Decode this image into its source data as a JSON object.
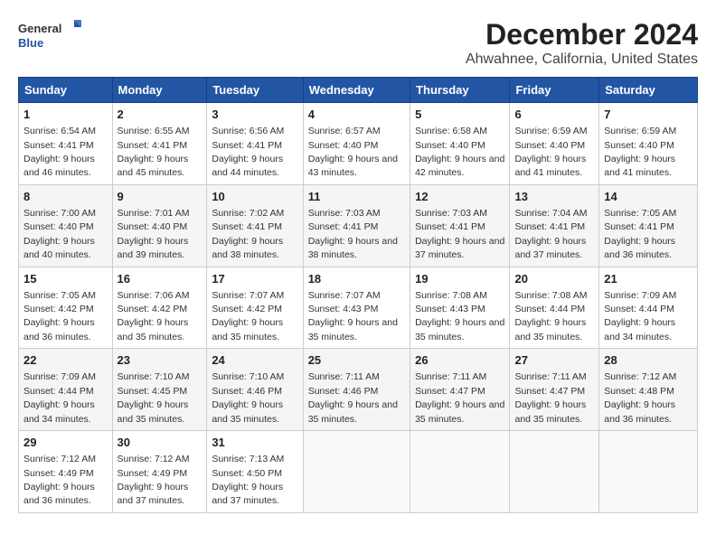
{
  "logo": {
    "general": "General",
    "blue": "Blue"
  },
  "title": "December 2024",
  "subtitle": "Ahwahnee, California, United States",
  "days_of_week": [
    "Sunday",
    "Monday",
    "Tuesday",
    "Wednesday",
    "Thursday",
    "Friday",
    "Saturday"
  ],
  "weeks": [
    [
      {
        "day": "1",
        "sunrise": "6:54 AM",
        "sunset": "4:41 PM",
        "daylight": "9 hours and 46 minutes."
      },
      {
        "day": "2",
        "sunrise": "6:55 AM",
        "sunset": "4:41 PM",
        "daylight": "9 hours and 45 minutes."
      },
      {
        "day": "3",
        "sunrise": "6:56 AM",
        "sunset": "4:41 PM",
        "daylight": "9 hours and 44 minutes."
      },
      {
        "day": "4",
        "sunrise": "6:57 AM",
        "sunset": "4:40 PM",
        "daylight": "9 hours and 43 minutes."
      },
      {
        "day": "5",
        "sunrise": "6:58 AM",
        "sunset": "4:40 PM",
        "daylight": "9 hours and 42 minutes."
      },
      {
        "day": "6",
        "sunrise": "6:59 AM",
        "sunset": "4:40 PM",
        "daylight": "9 hours and 41 minutes."
      },
      {
        "day": "7",
        "sunrise": "6:59 AM",
        "sunset": "4:40 PM",
        "daylight": "9 hours and 41 minutes."
      }
    ],
    [
      {
        "day": "8",
        "sunrise": "7:00 AM",
        "sunset": "4:40 PM",
        "daylight": "9 hours and 40 minutes."
      },
      {
        "day": "9",
        "sunrise": "7:01 AM",
        "sunset": "4:40 PM",
        "daylight": "9 hours and 39 minutes."
      },
      {
        "day": "10",
        "sunrise": "7:02 AM",
        "sunset": "4:41 PM",
        "daylight": "9 hours and 38 minutes."
      },
      {
        "day": "11",
        "sunrise": "7:03 AM",
        "sunset": "4:41 PM",
        "daylight": "9 hours and 38 minutes."
      },
      {
        "day": "12",
        "sunrise": "7:03 AM",
        "sunset": "4:41 PM",
        "daylight": "9 hours and 37 minutes."
      },
      {
        "day": "13",
        "sunrise": "7:04 AM",
        "sunset": "4:41 PM",
        "daylight": "9 hours and 37 minutes."
      },
      {
        "day": "14",
        "sunrise": "7:05 AM",
        "sunset": "4:41 PM",
        "daylight": "9 hours and 36 minutes."
      }
    ],
    [
      {
        "day": "15",
        "sunrise": "7:05 AM",
        "sunset": "4:42 PM",
        "daylight": "9 hours and 36 minutes."
      },
      {
        "day": "16",
        "sunrise": "7:06 AM",
        "sunset": "4:42 PM",
        "daylight": "9 hours and 35 minutes."
      },
      {
        "day": "17",
        "sunrise": "7:07 AM",
        "sunset": "4:42 PM",
        "daylight": "9 hours and 35 minutes."
      },
      {
        "day": "18",
        "sunrise": "7:07 AM",
        "sunset": "4:43 PM",
        "daylight": "9 hours and 35 minutes."
      },
      {
        "day": "19",
        "sunrise": "7:08 AM",
        "sunset": "4:43 PM",
        "daylight": "9 hours and 35 minutes."
      },
      {
        "day": "20",
        "sunrise": "7:08 AM",
        "sunset": "4:44 PM",
        "daylight": "9 hours and 35 minutes."
      },
      {
        "day": "21",
        "sunrise": "7:09 AM",
        "sunset": "4:44 PM",
        "daylight": "9 hours and 34 minutes."
      }
    ],
    [
      {
        "day": "22",
        "sunrise": "7:09 AM",
        "sunset": "4:44 PM",
        "daylight": "9 hours and 34 minutes."
      },
      {
        "day": "23",
        "sunrise": "7:10 AM",
        "sunset": "4:45 PM",
        "daylight": "9 hours and 35 minutes."
      },
      {
        "day": "24",
        "sunrise": "7:10 AM",
        "sunset": "4:46 PM",
        "daylight": "9 hours and 35 minutes."
      },
      {
        "day": "25",
        "sunrise": "7:11 AM",
        "sunset": "4:46 PM",
        "daylight": "9 hours and 35 minutes."
      },
      {
        "day": "26",
        "sunrise": "7:11 AM",
        "sunset": "4:47 PM",
        "daylight": "9 hours and 35 minutes."
      },
      {
        "day": "27",
        "sunrise": "7:11 AM",
        "sunset": "4:47 PM",
        "daylight": "9 hours and 35 minutes."
      },
      {
        "day": "28",
        "sunrise": "7:12 AM",
        "sunset": "4:48 PM",
        "daylight": "9 hours and 36 minutes."
      }
    ],
    [
      {
        "day": "29",
        "sunrise": "7:12 AM",
        "sunset": "4:49 PM",
        "daylight": "9 hours and 36 minutes."
      },
      {
        "day": "30",
        "sunrise": "7:12 AM",
        "sunset": "4:49 PM",
        "daylight": "9 hours and 37 minutes."
      },
      {
        "day": "31",
        "sunrise": "7:13 AM",
        "sunset": "4:50 PM",
        "daylight": "9 hours and 37 minutes."
      },
      null,
      null,
      null,
      null
    ]
  ]
}
